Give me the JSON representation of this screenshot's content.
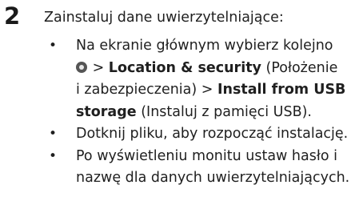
{
  "step": {
    "number": "2",
    "title": "Zainstaluj dane uwierzytelniające:"
  },
  "bullets": [
    {
      "marker": "•",
      "icon": "settings-gear-icon",
      "lines": [
        {
          "text": "Na ekranie głównym wybierz kolejno"
        },
        {
          "separator": " > ",
          "bold": "Location & security",
          "normal": " (Położenie"
        },
        {
          "normal": "i zabezpieczenia) > ",
          "bold": "Install from USB"
        },
        {
          "bold": "storage",
          "normal": " (Instaluj z pamięci USB)."
        }
      ]
    },
    {
      "marker": "•",
      "text": "Dotknij pliku, aby rozpocząć instalację."
    },
    {
      "marker": "•",
      "lines": [
        {
          "text": "Po wyświetleniu monitu ustaw hasło i"
        },
        {
          "text": "nazwę dla danych uwierzytelniających."
        }
      ]
    }
  ]
}
